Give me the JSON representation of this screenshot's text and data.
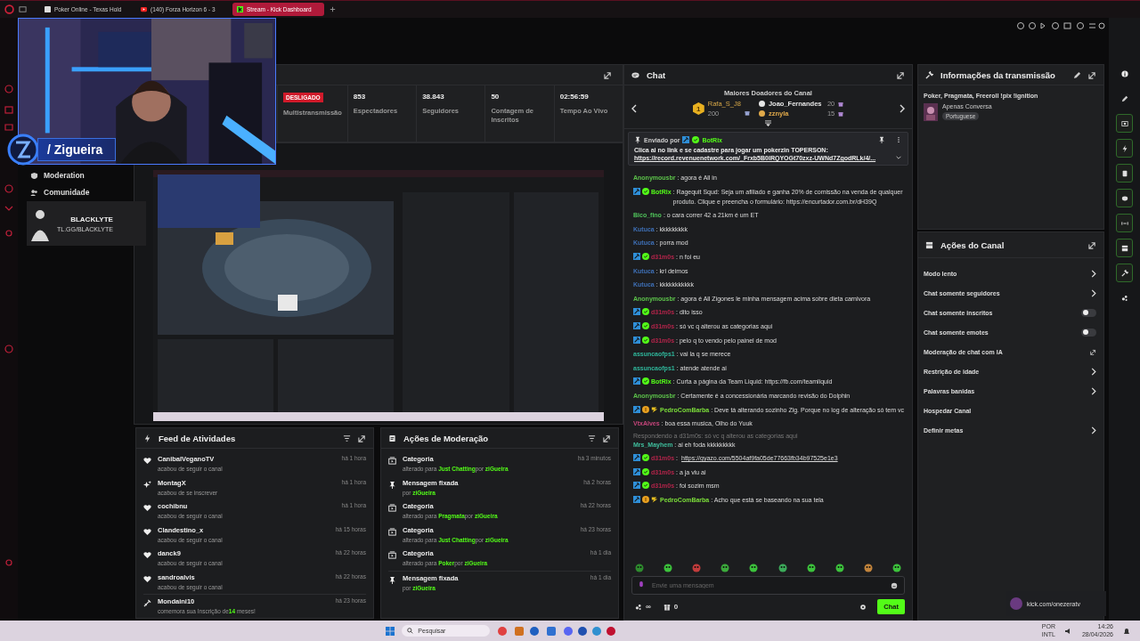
{
  "browser": {
    "tabs": [
      {
        "label": "Poker Online - Texas Hold",
        "selected": false,
        "kind": "page"
      },
      {
        "label": "(140) Forza Horizon 6 - 3",
        "selected": false,
        "kind": "video"
      },
      {
        "label": "Stream - Kick Dashboard",
        "selected": true,
        "kind": "kick"
      }
    ]
  },
  "webcam": {
    "streamer_name": "/ Zigueira",
    "sponsor": [
      "BLACKLYTE",
      "TL.GG/BLACKLYTE"
    ]
  },
  "nav": [
    {
      "label": "Moderation",
      "kind": "shield"
    },
    {
      "label": "Comunidade",
      "kind": "people"
    }
  ],
  "stats": {
    "status": "DESLIGADO",
    "status_label": "Multistransmissão",
    "items": [
      {
        "value": "853",
        "label": "Espectadores"
      },
      {
        "value": "38.843",
        "label": "Seguidores"
      },
      {
        "value": "50",
        "label": "Contagem de Inscritos"
      },
      {
        "value": "02:56:59",
        "label": "Tempo Ao Vivo"
      }
    ]
  },
  "activity_feed": {
    "title": "Feed de Atividades",
    "items": [
      {
        "kind": "follow",
        "user": "CanibalVeganoTV",
        "action": "acabou de seguir o canal",
        "time": "há 1 hora"
      },
      {
        "kind": "sub",
        "user": "MontagX",
        "action": "acabou de se inscrever",
        "time": "há 1 hora"
      },
      {
        "kind": "follow",
        "user": "cochibnu",
        "action": "acabou de seguir o canal",
        "time": "há 1 hora"
      },
      {
        "kind": "follow",
        "user": "Clandestino_x",
        "action": "acabou de seguir o canal",
        "time": "há 15 horas"
      },
      {
        "kind": "follow",
        "user": "danck9",
        "action": "acabou de seguir o canal",
        "time": "há 22 horas"
      },
      {
        "kind": "follow",
        "user": "sandroalvis",
        "action": "acabou de seguir o canal",
        "time": "há 22 horas"
      },
      {
        "kind": "resub",
        "user": "Mondaini10",
        "action": "comemora sua Inscrição de",
        "highlight": "14",
        "suffix": "meses!",
        "time": "há 23 horas"
      }
    ]
  },
  "moderation": {
    "title": "Ações de Moderação",
    "items": [
      {
        "kind": "category",
        "title": "Categoria",
        "prefix": "alterado para",
        "value": "Just Chatting",
        "by": "por",
        "user": "ziGueira",
        "time": "há 3 minutos"
      },
      {
        "kind": "pin",
        "title": "Mensagem fixada",
        "by": "por",
        "user": "ziGueira",
        "time": "há 2 horas"
      },
      {
        "kind": "category",
        "title": "Categoria",
        "prefix": "alterado para",
        "value": "Pragmata",
        "by": "por",
        "user": "ziGueira",
        "time": "há 22 horas"
      },
      {
        "kind": "category",
        "title": "Categoria",
        "prefix": "alterado para",
        "value": "Just Chatting",
        "by": "por",
        "user": "ziGueira",
        "time": "há 23 horas"
      },
      {
        "kind": "category",
        "title": "Categoria",
        "prefix": "alterado para",
        "value": "Poker",
        "by": "por",
        "user": "ziGueira",
        "time": "há 1 dia"
      },
      {
        "kind": "pin",
        "title": "Mensagem fixada",
        "by": "por",
        "user": "ziGueira",
        "time": "há 1 dia"
      }
    ]
  },
  "chat": {
    "title": "Chat",
    "donors": {
      "title": "Maiores Doadores do Canal",
      "top": {
        "rank": "1",
        "user": "Rafa_S_J8",
        "amount": "200"
      },
      "others": [
        {
          "user": "Joao_Fernandes",
          "amount": "20",
          "color": "#e6e6e6"
        },
        {
          "user": "zznyla",
          "amount": "15",
          "color": "#e0a94a"
        }
      ]
    },
    "pinned": {
      "label": "Enviado por",
      "user": "BotRix",
      "text": "Clica ai no link e se cadastre para jogar um pokerzin TOPERSON:",
      "link": "https://record.revenuenetwork.com/_Frxb5B0lRQYOGt70zxz-UWNd7ZgodRLk/4/..."
    },
    "messages": [
      {
        "user": "Anonymousbr",
        "color": "#5cc24a",
        "text": ": agora é All in"
      },
      {
        "user": "BotRix",
        "color": "#53fc18",
        "moderator": true,
        "verified": true,
        "text": ": Ragequit Squd: Seja um afiliado e ganha 20% de comissão na venda de qualquer produto. Clique e preencha o formulário: https://encurtador.com.br/dH39Q"
      },
      {
        "user": "Bico_fino",
        "color": "#4fc25a",
        "text": ": o cara correr 42 a 21km é um ET"
      },
      {
        "user": "Kutuca",
        "color": "#3e6fb5",
        "text": ": kkkkkkkkk"
      },
      {
        "user": "Kutuca",
        "color": "#3e6fb5",
        "text": ": porra mod"
      },
      {
        "user": "d31m0s",
        "color": "#b3244a",
        "moderator": true,
        "verified": true,
        "text": ": n foi eu"
      },
      {
        "user": "Kutuca",
        "color": "#3e6fb5",
        "text": ": krl deimos"
      },
      {
        "user": "Kutuca",
        "color": "#3e6fb5",
        "text": ": kkkkkkkkkkk"
      },
      {
        "user": "Anonymousbr",
        "color": "#5cc24a",
        "text": ": agora é All Zigones le minha mensagem acima sobre dieta carnivora"
      },
      {
        "user": "d31m0s",
        "color": "#b3244a",
        "moderator": true,
        "verified": true,
        "text": ": dito isso"
      },
      {
        "user": "d31m0s",
        "color": "#b3244a",
        "moderator": true,
        "verified": true,
        "text": ": só vc q alterou as categorias aqui"
      },
      {
        "user": "d31m0s",
        "color": "#b3244a",
        "moderator": true,
        "verified": true,
        "text": ": pelo q to vendo pelo painel de mod"
      },
      {
        "user": "assuncaofps1",
        "color": "#2fb59a",
        "text": ": vai la q se merece"
      },
      {
        "user": "assuncaofps1",
        "color": "#2fb59a",
        "text": ": atende atende ai"
      },
      {
        "user": "BotRix",
        "color": "#53fc18",
        "moderator": true,
        "verified": true,
        "text": ": Curta a página da Team Liquid: https://fb.com/teamliquid"
      },
      {
        "user": "Anonymousbr",
        "color": "#5cc24a",
        "text": ": Certamente é a concessionária marcando revisão do Dolphin"
      },
      {
        "user": "PedroComBarba",
        "color": "#7cde3a",
        "moderator": true,
        "subscriber": true,
        "gifter": true,
        "text": ": Deve tá alterando sozinho Zig. Porque no log de alteração só tem vc"
      },
      {
        "user": "VtxAlves",
        "color": "#c4457a",
        "text": ": boa essa musica, Olho do Yuuk"
      },
      {
        "user": "Mrs_Mayhem",
        "color": "#3fbf9d",
        "reply": "Respondendo a d31m0s: só vc q alterou as categorias aqui",
        "text": ": ai eh foda kkkkkkkkk"
      },
      {
        "user": "d31m0s",
        "color": "#b3244a",
        "moderator": true,
        "verified": true,
        "text": ":",
        "link": "https://gyazo.com/5504af9fa05de77663fb34b97525e1e3"
      },
      {
        "user": "d31m0s",
        "color": "#b3244a",
        "moderator": true,
        "verified": true,
        "text": ": a ja viu ai"
      },
      {
        "user": "d31m0s",
        "color": "#b3244a",
        "moderator": true,
        "verified": true,
        "text": ": foi sozim msm"
      },
      {
        "user": "PedroComBarba",
        "color": "#7cde3a",
        "moderator": true,
        "subscriber": true,
        "gifter": true,
        "text": ": Acho que está se baseando na sua tela"
      }
    ],
    "emotes": [
      {
        "color": "#2e8b2e"
      },
      {
        "color": "#3cc23c"
      },
      {
        "color": "#c23c3c"
      },
      {
        "color": "#3caa3c"
      },
      {
        "color": "#3cc23c"
      },
      {
        "color": "#3caa5a"
      },
      {
        "color": "#3cc23c"
      },
      {
        "color": "#3cc23c"
      },
      {
        "color": "#c2843c"
      },
      {
        "color": "#3cc23c"
      }
    ],
    "input": {
      "placeholder": "Envie uma mensagem"
    },
    "footer": {
      "points": "∞",
      "gifts": "0",
      "send": "Chat"
    }
  },
  "stream_info": {
    "title": "Informações da transmissão",
    "stream_title": "Poker, Pragmata, Freeroll !pix !ignition",
    "category": "Apenas Conversa",
    "tag": "Portuguese"
  },
  "channel_actions": {
    "title": "Ações do Canal",
    "items": [
      {
        "label": "Modo lento",
        "kind": "chevron"
      },
      {
        "label": "Chat somente seguidores",
        "kind": "chevron"
      },
      {
        "label": "Chat somente inscritos",
        "kind": "toggle",
        "on": false
      },
      {
        "label": "Chat somente emotes",
        "kind": "toggle",
        "on": false
      },
      {
        "label": "Moderação de chat com IA",
        "kind": "external"
      },
      {
        "label": "Restrição de idade",
        "kind": "chevron"
      },
      {
        "label": "Palavras banidas",
        "kind": "chevron"
      },
      {
        "label": "Hospedar Canal",
        "kind": "none"
      },
      {
        "label": "Definir metas",
        "kind": "chevron"
      }
    ]
  },
  "rail": [
    {
      "kind": "info",
      "on": false
    },
    {
      "kind": "pencil",
      "on": false
    },
    {
      "kind": "camera",
      "on": true
    },
    {
      "kind": "bolt",
      "on": true
    },
    {
      "kind": "note",
      "on": true
    },
    {
      "kind": "chat",
      "on": true
    },
    {
      "kind": "split",
      "on": true
    },
    {
      "kind": "box",
      "on": true
    },
    {
      "kind": "wrench",
      "on": true
    },
    {
      "kind": "dots",
      "on": false
    }
  ],
  "notification": {
    "url": "kick.com/onezeratv"
  },
  "taskbar": {
    "search": "Pesquisar",
    "language": "POR",
    "layout": "INTL",
    "time": "14:26",
    "date": "28/04/2026"
  }
}
